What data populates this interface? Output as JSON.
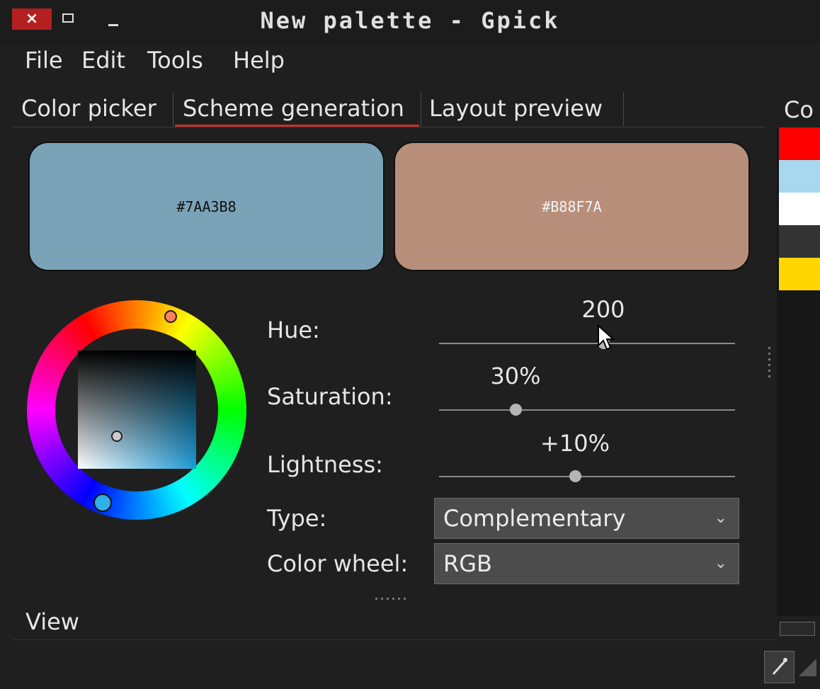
{
  "window": {
    "title": "New palette - Gpick",
    "close_glyph": "×"
  },
  "menu": [
    "File",
    "Edit",
    "Tools",
    "Help"
  ],
  "tabs": [
    {
      "label": "Color picker",
      "active": false
    },
    {
      "label": "Scheme generation",
      "active": true
    },
    {
      "label": "Layout preview",
      "active": false
    }
  ],
  "swatches": [
    {
      "hex_label": "#7AA3B8",
      "color": "#7AA3B8"
    },
    {
      "hex_label": "#B88F7A",
      "color": "#B88F7A"
    }
  ],
  "controls": {
    "hue": {
      "label": "Hue:",
      "value": "200",
      "fraction": 0.556
    },
    "saturation": {
      "label": "Saturation:",
      "value": "30%",
      "fraction": 0.26
    },
    "lightness": {
      "label": "Lightness:",
      "value": "+10%",
      "fraction": 0.46
    },
    "type": {
      "label": "Type:",
      "selected": "Complementary"
    },
    "color_wheel": {
      "label": "Color wheel:",
      "selected": "RGB"
    }
  },
  "palette": {
    "header": "Co",
    "colors": [
      "#FF0000",
      "#A8D8F0",
      "#FFFFFF",
      "#333333",
      "#FFD700"
    ]
  },
  "bottom": {
    "view_label": "View"
  },
  "icons": {
    "chevron": "⌄",
    "picker_icon": "eyedropper-icon"
  }
}
